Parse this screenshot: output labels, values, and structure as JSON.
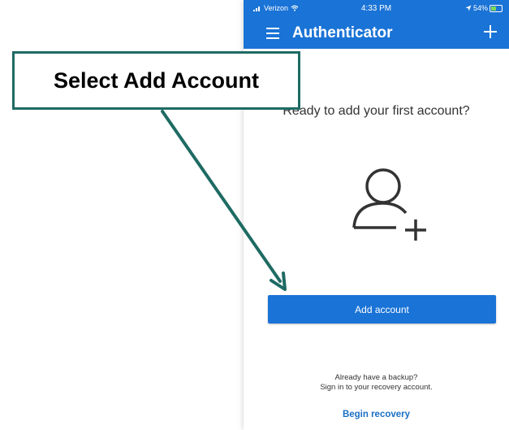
{
  "status_bar": {
    "carrier": "Verizon",
    "time": "4:33 PM",
    "battery": "54%"
  },
  "app_bar": {
    "title": "Authenticator",
    "menu_icon": "menu-icon",
    "add_icon": "plus-icon"
  },
  "main": {
    "prompt": "Ready to add your first account?",
    "illustration_icon": "add-person-icon",
    "add_account_label": "Add account",
    "backup_line1": "Already have a backup?",
    "backup_line2": "Sign in to your recovery account.",
    "begin_recovery_label": "Begin recovery"
  },
  "annotation": {
    "callout_text": "Select Add Account"
  },
  "colors": {
    "brand_blue": "#1a73d6",
    "link_blue": "#1a6fc4",
    "callout_teal": "#1e6b63"
  }
}
